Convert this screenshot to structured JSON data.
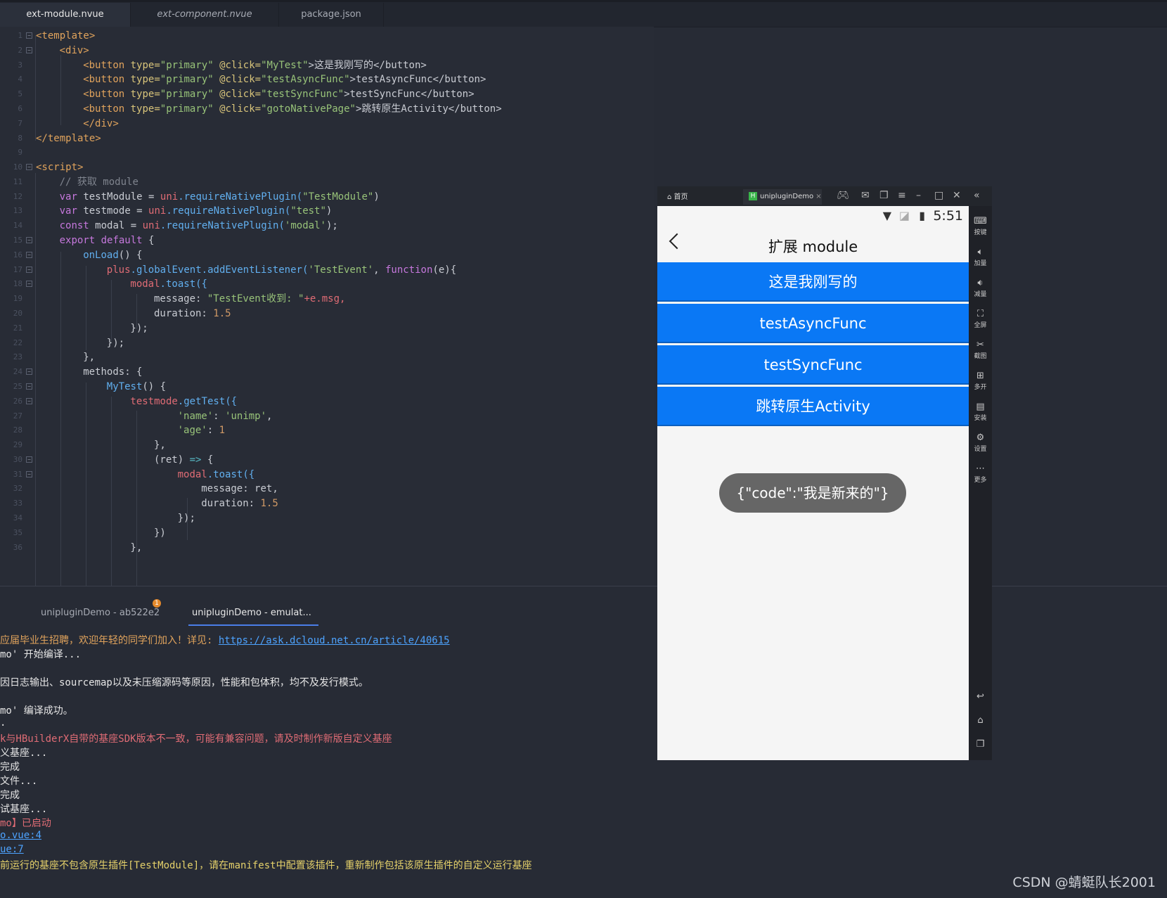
{
  "editor_tabs": [
    {
      "label": "ext-module.nvue"
    },
    {
      "label": "ext-component.nvue"
    },
    {
      "label": "package.json"
    }
  ],
  "code": [
    {
      "n": "1"
    },
    {
      "n": "2"
    },
    {
      "n": "3"
    },
    {
      "n": "4"
    },
    {
      "n": "5"
    },
    {
      "n": "6"
    },
    {
      "n": "7"
    },
    {
      "n": "8"
    },
    {
      "n": "9"
    },
    {
      "n": "10"
    },
    {
      "n": "11"
    },
    {
      "n": "12"
    },
    {
      "n": "13"
    },
    {
      "n": "14"
    },
    {
      "n": "15"
    },
    {
      "n": "16"
    },
    {
      "n": "17"
    },
    {
      "n": "18"
    },
    {
      "n": "19"
    },
    {
      "n": "20"
    },
    {
      "n": "21"
    },
    {
      "n": "22"
    },
    {
      "n": "23"
    },
    {
      "n": "24"
    },
    {
      "n": "25"
    },
    {
      "n": "26"
    },
    {
      "n": "27"
    },
    {
      "n": "28"
    },
    {
      "n": "29"
    },
    {
      "n": "30"
    },
    {
      "n": "31"
    },
    {
      "n": "32"
    },
    {
      "n": "33"
    },
    {
      "n": "34"
    },
    {
      "n": "35"
    },
    {
      "n": "36"
    }
  ],
  "code_text": {
    "l1a": "<template>",
    "l2a": "<div>",
    "l3a": "<button ",
    "l3b": "type=",
    "l3c": "\"primary\" ",
    "l3d": "@click=",
    "l3e": "\"MyTest\"",
    ">3f": "",
    "l3f": ">这是我刚写的</button>",
    "l4a": "<button ",
    "l4b": "type=",
    "l4c": "\"primary\" ",
    "l4d": "@click=",
    "l4e": "\"testAsyncFunc\"",
    "l4f": ">testAsyncFunc</button>",
    "l5a": "<button ",
    "l5b": "type=",
    "l5c": "\"primary\" ",
    "l5d": "@click=",
    "l5e": "\"testSyncFunc\"",
    "l5f": ">testSyncFunc</button>",
    "l6a": "<button ",
    "l6b": "type=",
    "l6c": "\"primary\" ",
    "l6d": "@click=",
    "l6e": "\"gotoNativePage\"",
    "l6f": ">跳转原生Activity</button>",
    "l7a": "</div>",
    "l8a": "</template>",
    "l10a": "<script>",
    "l11a": "// 获取 module",
    "l12a": "var ",
    "l12b": "testModule = ",
    "l12c": "uni",
    ".l12d": "",
    "l12d": ".requireNativePlugin(",
    "l12e": "\"TestModule\"",
    "l12f": ")",
    "l13a": "var ",
    "l13b": "testmode = ",
    "l13c": "uni",
    "l13d": ".requireNativePlugin(",
    "l13e": "\"test\"",
    "l13f": ")",
    "l14a": "const ",
    "l14b": "modal = ",
    "l14c": "uni",
    "l14d": ".requireNativePlugin(",
    "l14e": "'modal'",
    "l14f": ");",
    "l15a": "export default ",
    "l15b": "{",
    "l16a": "onLoad",
    "l16b": "() {",
    "l17a": "plus",
    "l17b": ".globalEvent.addEventListener(",
    "l17c": "'TestEvent'",
    "l17d": ", ",
    "l17e": "function",
    "l17f": "(e){",
    "l18a": "modal",
    "l18b": ".toast({",
    "l19a": "message: ",
    "l19b": "\"TestEvent收到: \"",
    "l19c": "+e.msg,",
    "l20a": "duration: ",
    "l20b": "1.5",
    "l21a": "});",
    "l22a": "});",
    "l23a": "},",
    "l24a": "methods: {",
    "l25a": "MyTest",
    "l25b": "() {",
    "l26a": "testmode",
    "l26b": ".getTest({",
    "l27a": "'name'",
    "l27b": ": ",
    "l27c": "'unimp'",
    "l27d": ",",
    "l28a": "'age'",
    "l28b": ": ",
    "l28c": "1",
    "l29a": "},",
    "l30a": "(ret) ",
    "l30b": "=>",
    " l30c": "",
    "l30c": " {",
    "l31a": "modal",
    "l31b": ".toast({",
    "l32a": "message: ret,",
    "l33a": "duration: ",
    "l33b": "1.5",
    "l34a": "});",
    "l35a": "})",
    "l36a": "},"
  },
  "console": {
    "tabs": [
      {
        "label": "unipluginDemo - ab522e2"
      },
      {
        "label": "unipluginDemo - emulat..."
      }
    ],
    "badge": "1",
    "lines": {
      "c1a": "应届毕业生招聘，欢迎年轻的同学们加入！详见: ",
      "c1b": "https://ask.dcloud.net.cn/article/40615",
      "c2": "mo' 开始编译...",
      "c3": "因日志输出、sourcemap以及未压缩源码等原因，性能和包体积，均不及发行模式。",
      "c4": "mo' 编译成功。",
      "c5": ".",
      "c6": "k与HBuilderX自带的基座SDK版本不一致，可能有兼容问题，请及时制作新版自定义基座",
      "c7": "义基座...",
      "c8": "完成",
      "c9": "文件...",
      "c10": "完成",
      "c11": "试基座...",
      "c12": "mo】已启动",
      "c13": "o.vue:4",
      "c14": "ue:7",
      "c15": "前运行的基座不包含原生插件[TestModule]，请在manifest中配置该插件，重新制作包括该原生插件的自定义运行基座"
    }
  },
  "emulator": {
    "home_label": "首页",
    "tab_label": "unipluginDemo",
    "time": "5:51",
    "nav_title": "扩展 module",
    "buttons": [
      {
        "label": "这是我刚写的"
      },
      {
        "label": "testAsyncFunc"
      },
      {
        "label": "testSyncFunc"
      },
      {
        "label": "跳转原生Activity"
      }
    ],
    "toast": "{\"code\":\"我是新来的\"}",
    "sidebar": [
      {
        "label": "按键",
        "icon": "keyboard-icon"
      },
      {
        "label": "加量",
        "icon": "volume-up-icon"
      },
      {
        "label": "减量",
        "icon": "volume-down-icon"
      },
      {
        "label": "全屏",
        "icon": "fullscreen-icon"
      },
      {
        "label": "截图",
        "icon": "scissors-icon"
      },
      {
        "label": "多开",
        "icon": "multi-open-icon"
      },
      {
        "label": "安装",
        "icon": "apk-install-icon"
      },
      {
        "label": "设置",
        "icon": "gear-icon"
      },
      {
        "label": "更多",
        "icon": "more-icon"
      }
    ]
  },
  "watermark": "CSDN @蜻蜓队长2001",
  "colors": {
    "button_blue": "#0a78f5",
    "toast_bg": "#666666",
    "editor_bg": "#282c36"
  }
}
